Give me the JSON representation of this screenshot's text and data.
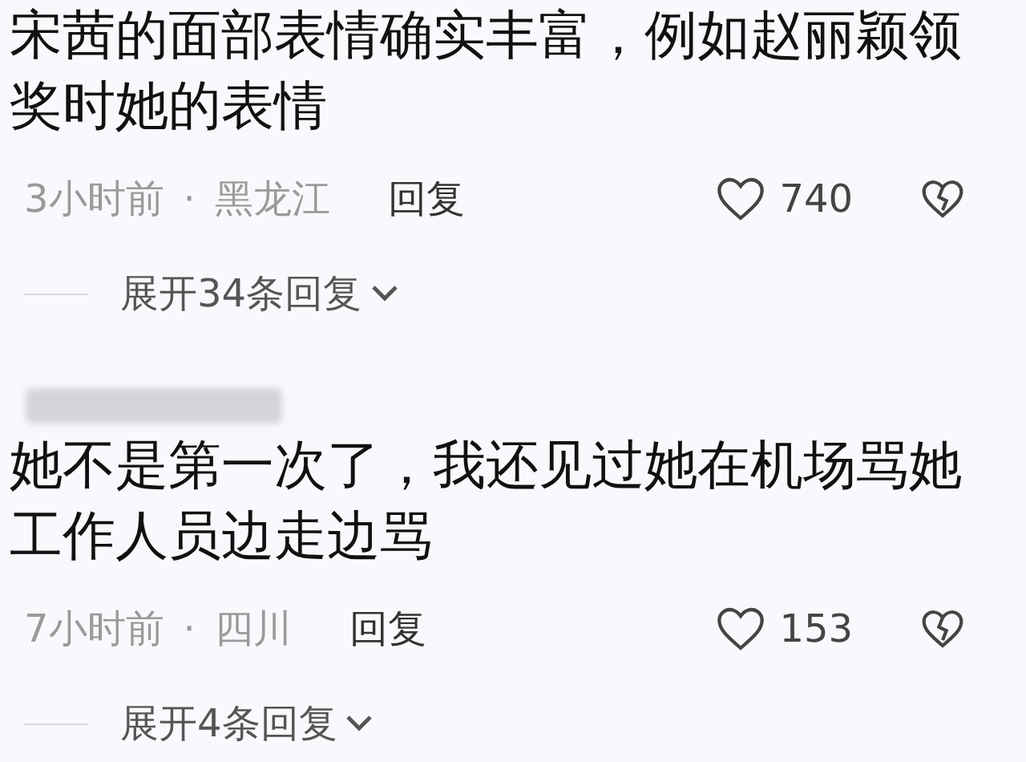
{
  "comments": [
    {
      "author_blurred": false,
      "text": "宋茜的面部表情确实丰富，例如赵丽颖领奖时她的表情",
      "time": "3小时前",
      "separator": "·",
      "location": "黑龙江",
      "reply": "回复",
      "likes": "740",
      "expand": "展开34条回复"
    },
    {
      "author_blurred": true,
      "text": "她不是第一次了，我还见过她在机场骂她工作人员边走边骂",
      "time": "7小时前",
      "separator": "·",
      "location": "四川",
      "reply": "回复",
      "likes": "153",
      "expand": "展开4条回复"
    }
  ]
}
